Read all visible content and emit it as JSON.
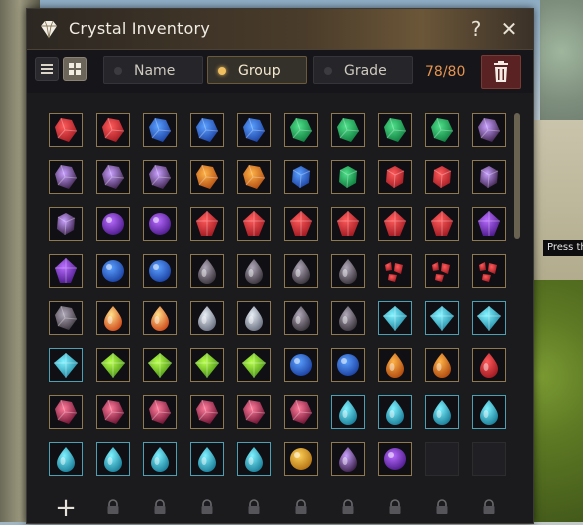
{
  "window": {
    "title": "Crystal Inventory",
    "help_label": "?",
    "close_label": "✕",
    "title_icon": "crystal-diamond-icon",
    "accent": "#e69450"
  },
  "toolbar": {
    "list_view_icon": "list-view-icon",
    "grid_view_icon": "grid-view-icon",
    "sort_name": "Name",
    "sort_group": "Group",
    "sort_grade": "Grade",
    "selected_sort": "Group",
    "count": "78/80",
    "delete_icon": "trash-icon"
  },
  "world": {
    "tooltip_text": "Press th"
  },
  "grid": {
    "add_label": "+",
    "crystals": [
      [
        "red-shard",
        "red-shard",
        "blue-shard",
        "blue-shard",
        "blue-shard",
        "green-shard",
        "green-shard",
        "green-shard",
        "green-shard",
        "violet-shard"
      ],
      [
        "violet-shard",
        "violet-shard",
        "violet-shard",
        "orange-shard",
        "orange-shard",
        "blue-chunk",
        "green-chunk",
        "red-gem",
        "red-gem",
        "violet-gem"
      ],
      [
        "violet-gem",
        "purple-orb",
        "purple-orb",
        "red-crystal",
        "red-crystal",
        "red-crystal",
        "red-crystal",
        "red-crystal",
        "red-crystal",
        "purple-crystal"
      ],
      [
        "purple-crystal",
        "blue-orb",
        "blue-orb",
        "dark-drop",
        "dark-drop",
        "dark-drop",
        "dark-drop",
        "red-fragments",
        "red-fragments",
        "red-fragments"
      ],
      [
        "dark-red-shard",
        "fire-drop",
        "fire-drop",
        "silver-drop",
        "silver-drop",
        "dark-drop",
        "dark-drop",
        "cyan-prism",
        "cyan-prism",
        "cyan-prism"
      ],
      [
        "cyan-prism",
        "lime-prism",
        "lime-prism",
        "lime-prism",
        "lime-prism",
        "blue-star",
        "blue-star",
        "orange-drop",
        "orange-drop",
        "red-drop"
      ],
      [
        "ruby-shard",
        "ruby-shard",
        "ruby-shard",
        "ruby-shard",
        "ruby-shard",
        "ruby-shard",
        "cyan-drop",
        "cyan-drop",
        "cyan-drop",
        "cyan-drop"
      ],
      [
        "cyan-drop",
        "cyan-drop",
        "cyan-drop",
        "cyan-drop",
        "cyan-drop",
        "gold-orb",
        "violet-drop",
        "purple-star",
        "empty",
        "empty"
      ]
    ],
    "lock_icon": "lock-icon"
  }
}
